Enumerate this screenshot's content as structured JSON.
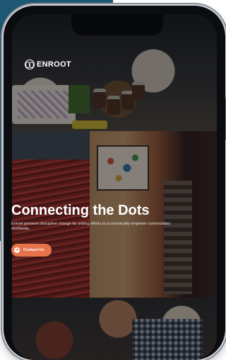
{
  "header": {
    "brand": "ENROOT"
  },
  "hero": {
    "title": "Connecting the Dots",
    "subtitle": "Enroot pioneers disruptive change by uniting efforts to economically empower communities worldwide.",
    "cta_label": "Contact Us",
    "cta_icon": "arrow-right-icon"
  },
  "colors": {
    "accent": "#e8734a",
    "background_panel": "#1f5873",
    "device_frame": "#0b0c0f"
  }
}
